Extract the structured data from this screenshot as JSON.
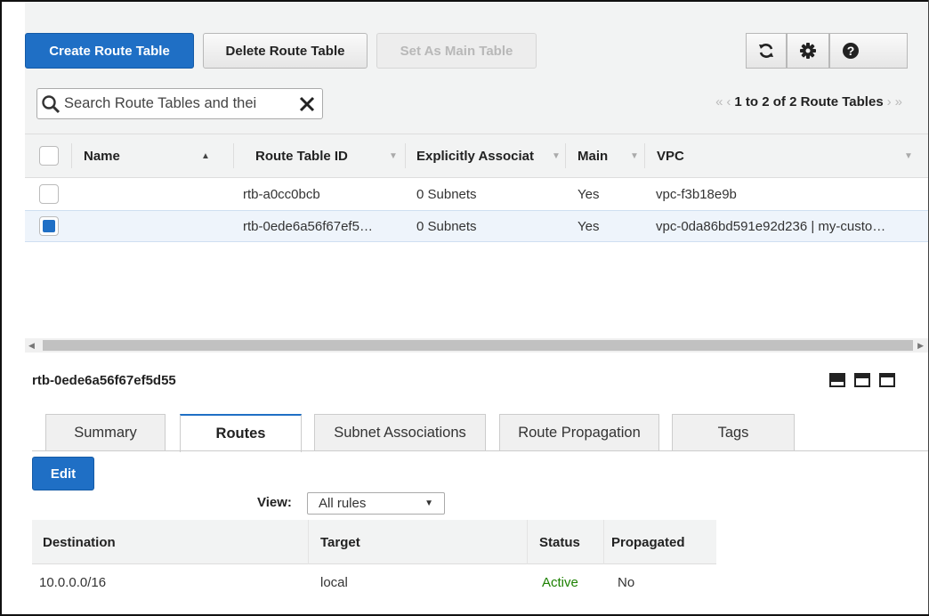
{
  "toolbar": {
    "create_label": "Create Route Table",
    "delete_label": "Delete Route Table",
    "set_main_label": "Set As Main Table",
    "icons": [
      "refresh-icon",
      "gear-icon",
      "help-icon"
    ]
  },
  "search": {
    "text": "Search Route Tables and thei"
  },
  "pager": {
    "label": "1 to 2 of 2 Route Tables"
  },
  "table": {
    "columns": [
      "Name",
      "Route Table ID",
      "Explicitly Associat",
      "Main",
      "VPC"
    ],
    "rows": [
      {
        "name": "",
        "id": "rtb-a0cc0bcb",
        "assoc": "0 Subnets",
        "main": "Yes",
        "vpc": "vpc-f3b18e9b",
        "selected": false
      },
      {
        "name": "",
        "id": "rtb-0ede6a56f67ef5…",
        "assoc": "0 Subnets",
        "main": "Yes",
        "vpc": "vpc-0da86bd591e92d236 | my-custo…",
        "selected": true
      }
    ]
  },
  "detail": {
    "title": "rtb-0ede6a56f67ef5d55",
    "tabs": [
      "Summary",
      "Routes",
      "Subnet Associations",
      "Route Propagation",
      "Tags"
    ],
    "active_tab": "Routes",
    "edit_label": "Edit",
    "view_label": "View:",
    "view_value": "All rules"
  },
  "routes": {
    "columns": [
      "Destination",
      "Target",
      "Status",
      "Propagated"
    ],
    "rows": [
      {
        "destination": "10.0.0.0/16",
        "target": "local",
        "status": "Active",
        "propagated": "No"
      }
    ]
  },
  "colors": {
    "primary": "#1f6fc5",
    "active_status": "#1d8102"
  }
}
